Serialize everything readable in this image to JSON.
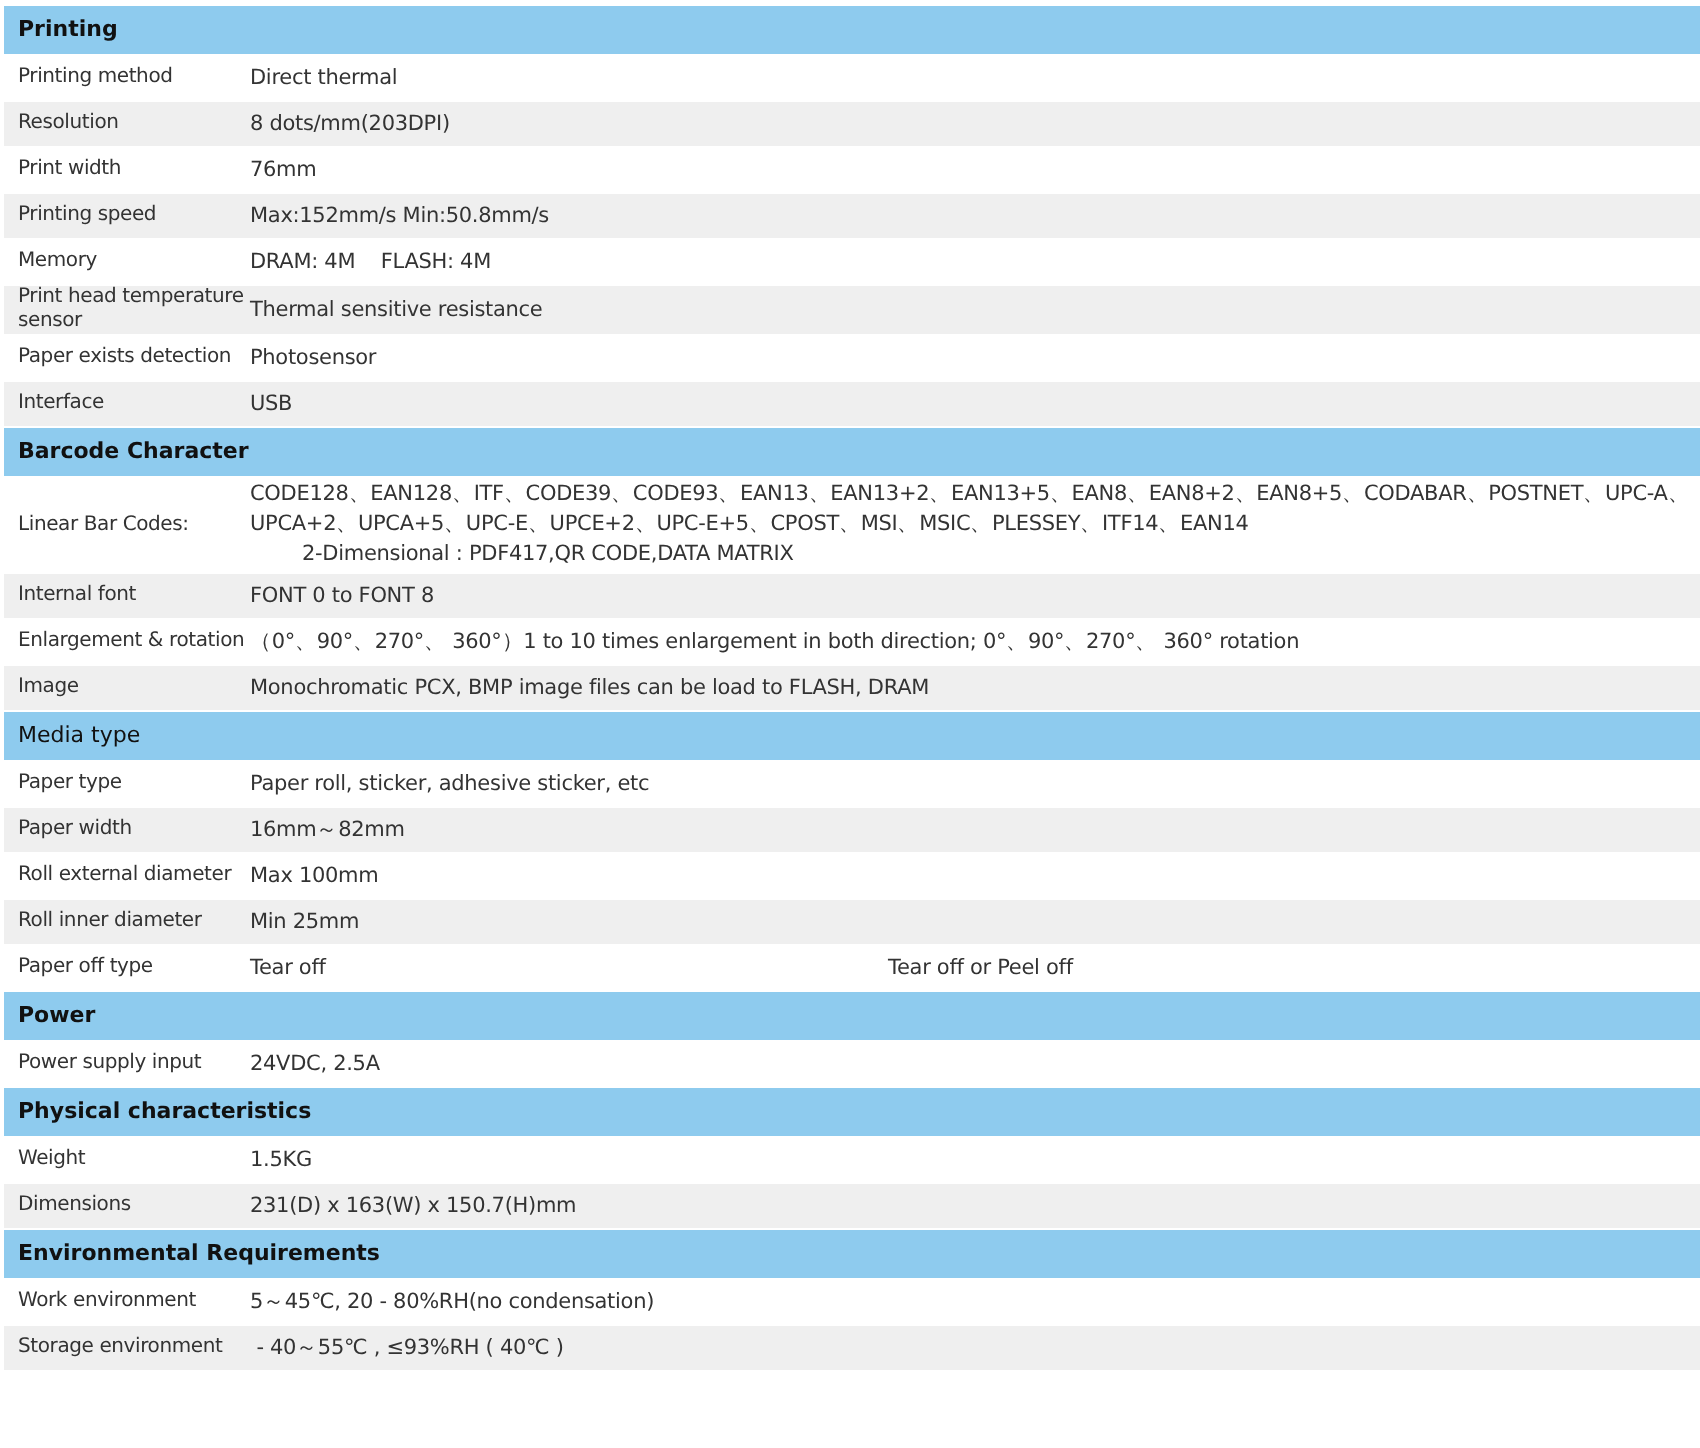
{
  "sections": [
    {
      "title": "Printing",
      "bold": true,
      "rows": [
        {
          "label": "Printing method",
          "cells": [
            "Direct thermal"
          ]
        },
        {
          "label": "Resolution",
          "cells": [
            "8 dots/mm(203DPI)"
          ]
        },
        {
          "label": "Print width",
          "cells": [
            "76mm"
          ]
        },
        {
          "label": "Printing speed",
          "cells": [
            "Max:152mm/s Min:50.8mm/s"
          ]
        },
        {
          "label": "Memory",
          "cells": [
            "DRAM: 4M    FLASH: 4M"
          ]
        },
        {
          "label": "Print head temperature sensor",
          "cells": [
            "Thermal sensitive resistance"
          ]
        },
        {
          "label": "Paper exists detection",
          "cells": [
            "Photosensor"
          ]
        },
        {
          "label": "Interface",
          "cells": [
            "USB"
          ]
        }
      ]
    },
    {
      "title": "Barcode Character",
      "bold": true,
      "rows": [
        {
          "label": "Linear Bar Codes:",
          "lines": [
            "CODE128、EAN128、ITF、CODE39、CODE93、EAN13、EAN13+2、EAN13+5、EAN8、EAN8+2、EAN8+5、CODABAR、POSTNET、UPC-A、",
            "UPCA+2、UPCA+5、UPC-E、UPCE+2、UPC-E+5、CPOST、MSI、MSIC、PLESSEY、ITF14、EAN14"
          ],
          "sub_line": "2-Dimensional : PDF417,QR CODE,DATA MATRIX"
        },
        {
          "label": "Internal font",
          "cells": [
            "FONT 0 to FONT 8"
          ]
        },
        {
          "label": "Enlargement & rotation",
          "cells": [
            "（0°、90°、270°、 360°）1 to 10 times enlargement in both direction; 0°、90°、270°、 360° rotation"
          ]
        },
        {
          "label": "Image",
          "cells": [
            "Monochromatic PCX, BMP image files can be load to FLASH, DRAM"
          ]
        }
      ]
    },
    {
      "title": "Media type",
      "bold": false,
      "rows": [
        {
          "label": "Paper type",
          "cells": [
            "Paper roll, sticker, adhesive sticker, etc"
          ]
        },
        {
          "label": "Paper width",
          "cells": [
            "16mm～82mm"
          ]
        },
        {
          "label": "Roll external diameter",
          "cells": [
            "Max 100mm"
          ]
        },
        {
          "label": "Roll inner diameter",
          "cells": [
            "Min 25mm"
          ]
        },
        {
          "label": "Paper off type",
          "cells": [
            "Tear off",
            "Tear off or Peel off"
          ]
        }
      ]
    },
    {
      "title": "Power",
      "bold": true,
      "rows": [
        {
          "label": "Power supply input",
          "cells": [
            "24VDC, 2.5A"
          ]
        }
      ]
    },
    {
      "title": "Physical characteristics",
      "bold": true,
      "rows": [
        {
          "label": "Weight",
          "cells": [
            "1.5KG"
          ]
        },
        {
          "label": "Dimensions",
          "cells": [
            "231(D) x 163(W) x 150.7(H)mm"
          ]
        }
      ]
    },
    {
      "title": "Environmental Requirements",
      "bold": true,
      "rows": [
        {
          "label": "Work environment",
          "cells": [
            "5～45℃, 20 - 80%RH(no condensation)"
          ]
        },
        {
          "label": "Storage environment",
          "cells": [
            " - 40～55℃ , ≤93%RH ( 40℃ )"
          ]
        }
      ]
    }
  ]
}
